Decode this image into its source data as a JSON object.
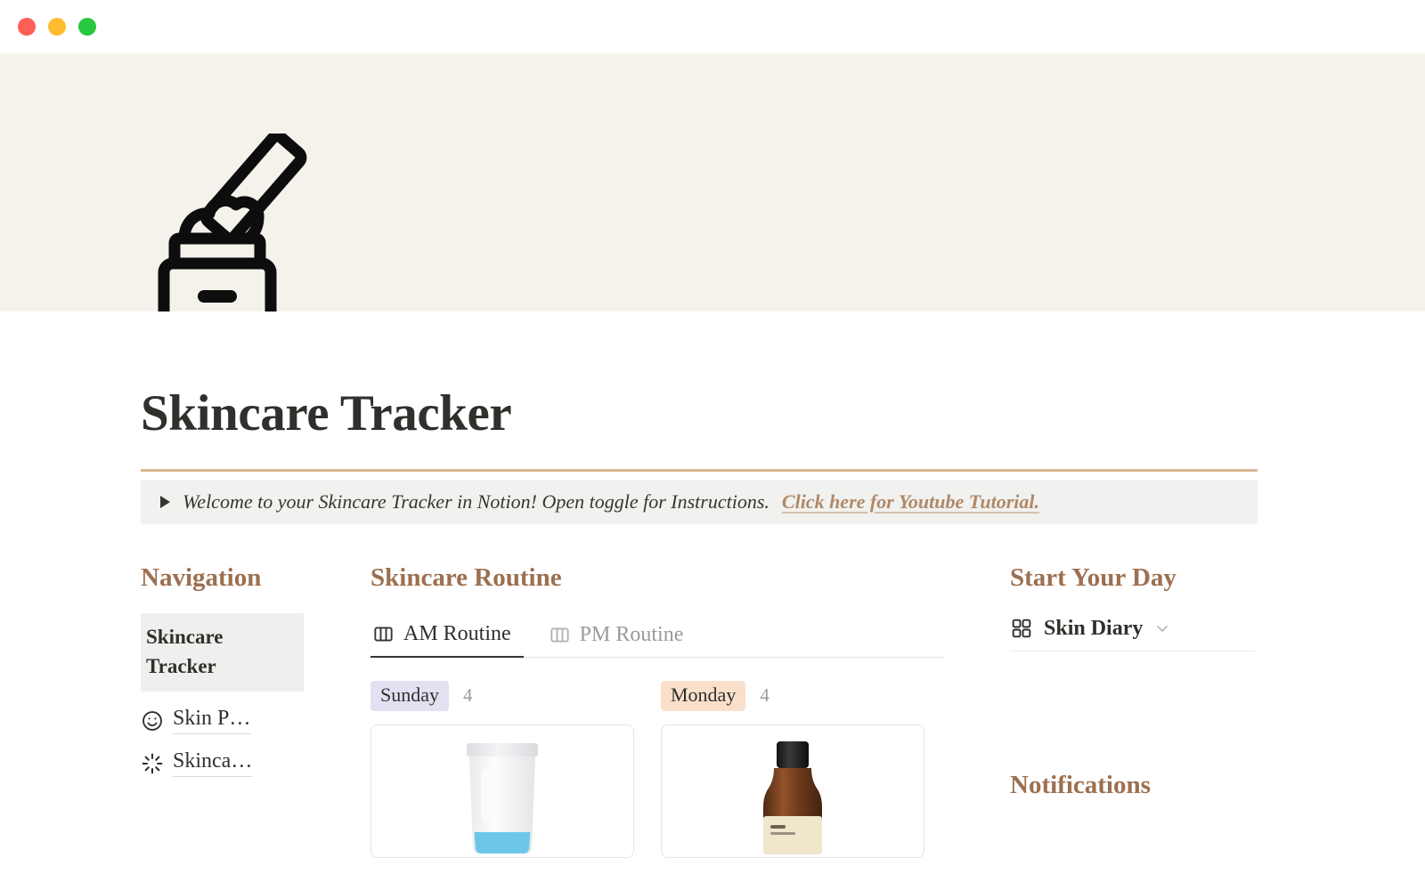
{
  "window": {
    "traffic_lights": [
      {
        "name": "close-button",
        "color": "#ff5f57"
      },
      {
        "name": "minimize-button",
        "color": "#febc2e"
      },
      {
        "name": "maximize-button",
        "color": "#28c840"
      }
    ]
  },
  "cover": {
    "background_color": "#f5f2ec",
    "icon_name": "cream-jar-icon"
  },
  "page": {
    "title": "Skincare Tracker",
    "divider_color": "#d6b793"
  },
  "callout": {
    "toggle_icon": "triangle-right-icon",
    "text": "Welcome to your Skincare Tracker in Notion! Open toggle for Instructions.",
    "link_text": "Click here for Youtube Tutorial.",
    "link_color": "#b08968",
    "background_color": "#f1f1ef"
  },
  "navigation": {
    "heading": "Navigation",
    "active_item": "Skincare Tracker",
    "links": [
      {
        "icon": "smiley-face-icon",
        "label": "Skin P…"
      },
      {
        "icon": "sparkle-icon",
        "label": "Skinca…"
      }
    ]
  },
  "routine": {
    "heading": "Skincare Routine",
    "tabs": [
      {
        "icon": "board-view-icon",
        "label": "AM Routine",
        "active": true
      },
      {
        "icon": "board-view-icon",
        "label": "PM Routine",
        "active": false
      }
    ],
    "columns": [
      {
        "day": "Sunday",
        "count": "4",
        "badge_color": "#e5dff2",
        "card_product": "white-cream-tube"
      },
      {
        "day": "Monday",
        "count": "4",
        "badge_color": "#fae0ca",
        "card_product": "amber-serum-bottle"
      }
    ]
  },
  "start_your_day": {
    "heading": "Start Your Day",
    "database": {
      "icon": "gallery-view-icon",
      "label": "Skin Diary",
      "chevron": "chevron-down-icon"
    }
  },
  "notifications": {
    "heading": "Notifications"
  },
  "accent_color": "#9c6f50"
}
